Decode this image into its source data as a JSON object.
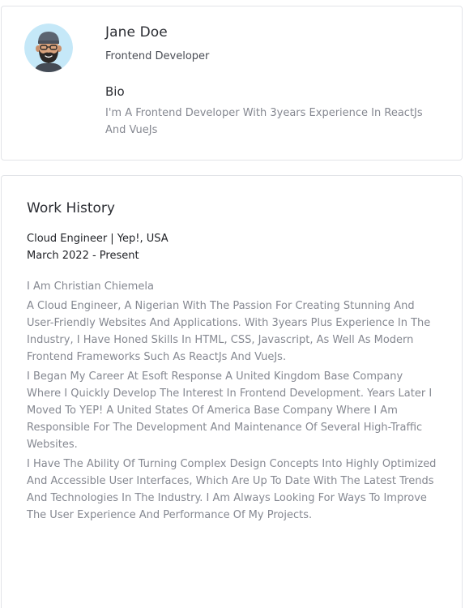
{
  "profile": {
    "name": "Jane Doe",
    "role": "Frontend Developer",
    "bio_heading": "Bio",
    "bio_text": "I'm A Frontend Developer With 3years Experience In ReactJs And VueJs",
    "avatar_icon": "bearded-man-avatar-icon"
  },
  "work_history": {
    "title": "Work History",
    "job_title": "Cloud Engineer | Yep!, USA",
    "job_dates": "March 2022 - Present",
    "paragraphs": [
      "I Am Christian Chiemela",
      "A Cloud Engineer, A Nigerian With The Passion For Creating Stunning And User-Friendly Websites And Applications. With 3years Plus Experience In The Industry, I Have Honed Skills In HTML, CSS, Javascript, As Well As Modern Frontend Frameworks Such As ReactJs And VueJs.",
      "I Began My Career At Esoft Response A United Kingdom Base Company Where I Quickly Develop The Interest In Frontend Development. Years Later I Moved To YEP! A United States Of America Base Company Where I Am Responsible For The Development And Maintenance Of Several High-Traffic Websites.",
      "I Have The Ability Of Turning Complex Design Concepts Into Highly Optimized And Accessible User Interfaces, Which Are Up To Date With The Latest Trends And Technologies In The Industry. I Am Always Looking For Ways To Improve The User Experience And Performance Of My Projects."
    ]
  },
  "colors": {
    "avatar_bg": "#c5e8f8",
    "border": "#e2e4e8",
    "muted_text": "#858891"
  }
}
